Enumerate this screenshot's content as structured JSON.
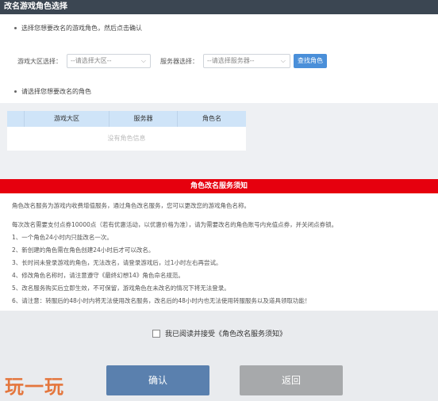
{
  "title": "改名游戏角色选择",
  "steps": {
    "step1": "选择您想要改名的游戏角色，然后点击确认",
    "step2": "请选择您想要改名的角色"
  },
  "filters": {
    "region_label": "游戏大区选择：",
    "region_value": "--请选择大区--",
    "server_label": "服务器选择：",
    "server_value": "--请选择服务器--",
    "search_button": "查找角色"
  },
  "table": {
    "headers": [
      "游戏大区",
      "服务器",
      "角色名"
    ],
    "empty_text": "没有角色信息"
  },
  "notice": {
    "title": "角色改名服务须知",
    "lines": [
      "角色改名服务为游戏内收费增值服务，通过角色改名服务，您可以更改您的游戏角色名称。",
      "每次改名需要支付点券10000点（若有优惠活动，以优惠价格为准），请为需要改名的角色账号内充值点券，并关闭点券锁。",
      "1、一个角色24小时内只能改名一次。",
      "2、新创建的角色需在角色创建24小时后才可以改名。",
      "3、长时间未登录游戏的角色，无法改名，请登录游戏后，过1小时左右再尝试。",
      "4、修改角色名称时，请注意遵守《最终幻想14》角色命名规范。",
      "5、改名服务购买后立即生效，不可保留，游戏角色在未改名的情况下将无法登录。",
      "6、请注意：转服后的48小时内将无法使用改名服务，改名后的48小时内也无法使用转服服务以及道具领取功能！"
    ]
  },
  "agree": {
    "label": "我已阅读并接受《角色改名服务须知》"
  },
  "buttons": {
    "confirm": "确认",
    "back": "返回"
  },
  "watermark": "玩一玩"
}
